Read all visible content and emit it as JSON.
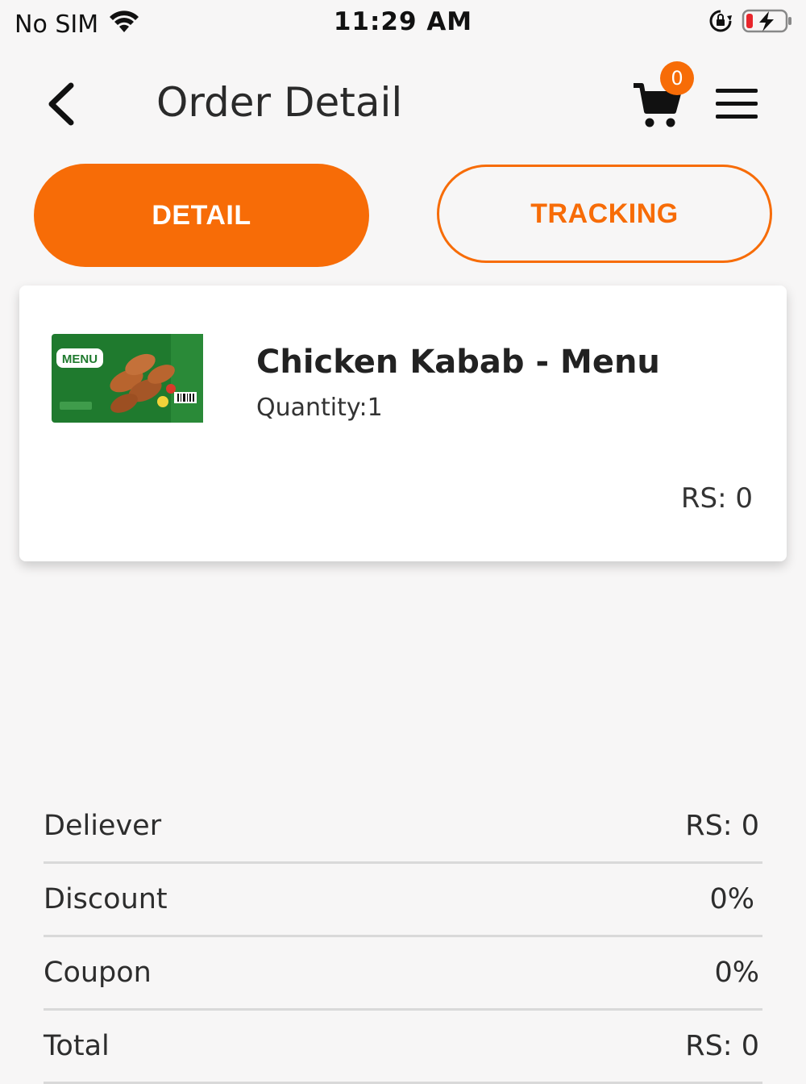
{
  "status_bar": {
    "carrier": "No SIM",
    "time": "11:29 AM",
    "icons": [
      "wifi-icon",
      "rotation-lock-icon",
      "battery-charging-icon"
    ]
  },
  "header": {
    "title": "Order Detail",
    "cart_count": "0",
    "icons": [
      "back-arrow-icon",
      "cart-icon",
      "hamburger-menu-icon"
    ]
  },
  "tabs": [
    {
      "label": "DETAIL",
      "active": true
    },
    {
      "label": "TRACKING",
      "active": false
    }
  ],
  "order_items": [
    {
      "name": "Chicken Kabab - Menu",
      "quantity": "Quantity:1",
      "price": "RS: 0",
      "image": "chicken-kabab-package"
    }
  ],
  "summary": [
    {
      "label": "Deliever",
      "value": "RS: 0"
    },
    {
      "label": "Discount",
      "value": "0%"
    },
    {
      "label": "Coupon",
      "value": "0%"
    },
    {
      "label": "Total",
      "value": "RS: 0"
    }
  ],
  "colors": {
    "accent": "#f76c07",
    "background": "#f7f6f6",
    "card": "#ffffff",
    "divider": "#d9d9d9"
  }
}
